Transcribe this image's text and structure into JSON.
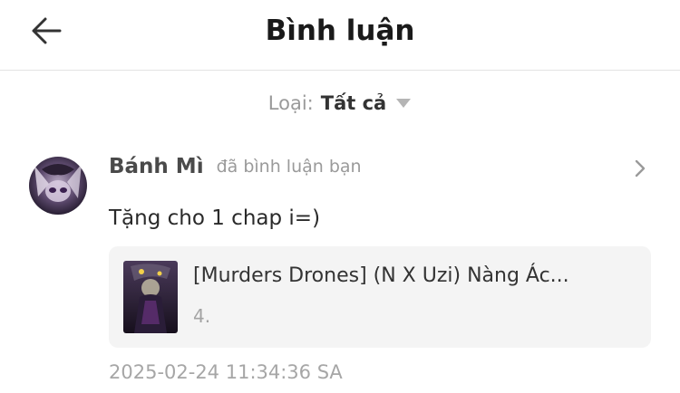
{
  "header": {
    "title": "Bình luận",
    "back_icon": "arrow-left-icon"
  },
  "filter": {
    "label": "Loại:",
    "value": "Tất cả",
    "caret_icon": "caret-down-icon"
  },
  "comment": {
    "username": "Bánh Mì",
    "action_text": "đã bình luận bạn",
    "text": "Tặng cho 1 chap i=)",
    "timestamp": "2025-02-24 11:34:36 SA",
    "chevron_icon": "chevron-right-icon",
    "story": {
      "title": "[Murders Drones] (N X Uzi) Nàng Ác...",
      "chapter": "4."
    }
  },
  "colors": {
    "muted": "#9a9a9a",
    "card_bg": "#f4f4f4",
    "divider": "#e3e3e3"
  }
}
